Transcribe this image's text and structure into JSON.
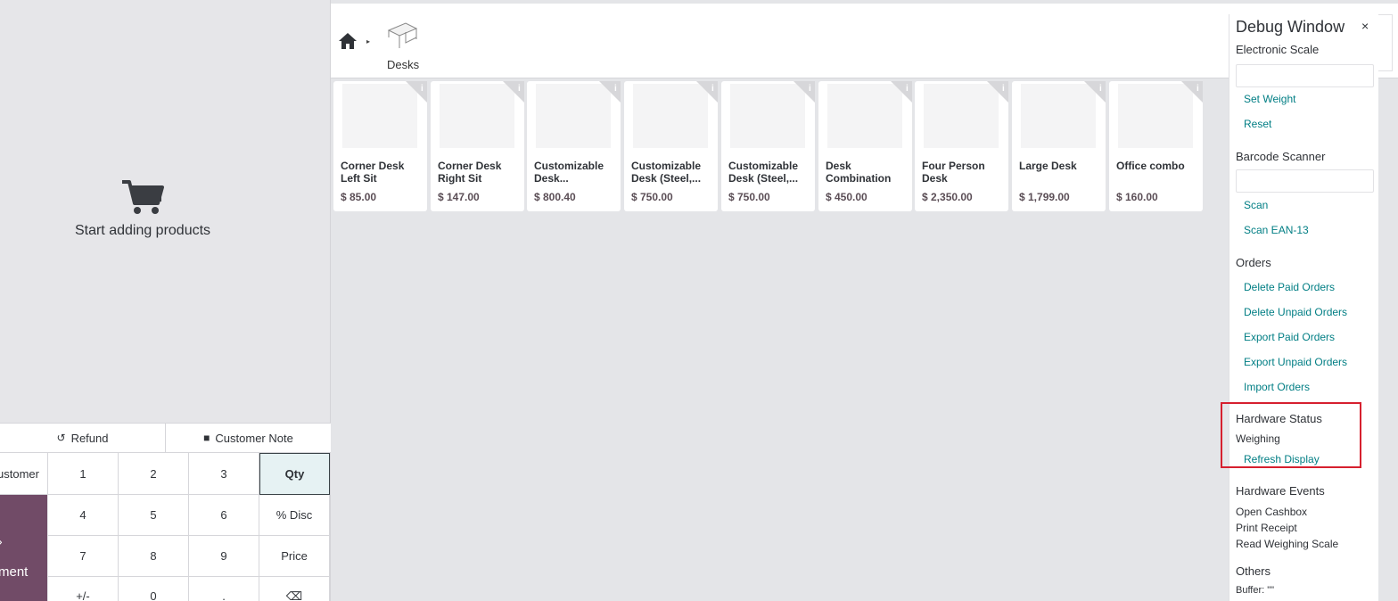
{
  "order_pane": {
    "empty_message": "Start adding products",
    "refund_label": "Refund",
    "customer_note_label": "Customer Note",
    "customer_label": "ustomer",
    "payment_label": "ment",
    "keypad": [
      {
        "label": "1"
      },
      {
        "label": "2"
      },
      {
        "label": "3"
      },
      {
        "label": "Qty"
      },
      {
        "label": "4"
      },
      {
        "label": "5"
      },
      {
        "label": "6"
      },
      {
        "label": "% Disc"
      },
      {
        "label": "7"
      },
      {
        "label": "8"
      },
      {
        "label": "9"
      },
      {
        "label": "Price"
      },
      {
        "label": "+/-"
      },
      {
        "label": "0"
      },
      {
        "label": "."
      },
      {
        "label": "⌫"
      }
    ]
  },
  "breadcrumb": {
    "category_label": "Desks"
  },
  "products": [
    {
      "name": "Corner Desk Left Sit",
      "price": "$ 85.00"
    },
    {
      "name": "Corner Desk Right Sit",
      "price": "$ 147.00"
    },
    {
      "name": "Customizable Desk...",
      "price": "$ 800.40"
    },
    {
      "name": "Customizable Desk (Steel,...",
      "price": "$ 750.00"
    },
    {
      "name": "Customizable Desk (Steel,...",
      "price": "$ 750.00"
    },
    {
      "name": "Desk Combination",
      "price": "$ 450.00"
    },
    {
      "name": "Four Person Desk",
      "price": "$ 2,350.00"
    },
    {
      "name": "Large Desk",
      "price": "$ 1,799.00"
    },
    {
      "name": "Office combo",
      "price": "$ 160.00"
    }
  ],
  "debug": {
    "title": "Debug Window",
    "close": "×",
    "scale_section": "Electronic Scale",
    "set_weight": "Set Weight",
    "reset": "Reset",
    "barcode_section": "Barcode Scanner",
    "scan": "Scan",
    "scan_ean": "Scan EAN-13",
    "orders_section": "Orders",
    "delete_paid": "Delete Paid Orders",
    "delete_unpaid": "Delete Unpaid Orders",
    "export_paid": "Export Paid Orders",
    "export_unpaid": "Export Unpaid Orders",
    "import_orders": "Import Orders",
    "hw_status_section": "Hardware Status",
    "weighing": "Weighing",
    "refresh_display": "Refresh Display",
    "hw_events_section": "Hardware Events",
    "open_cashbox": "Open Cashbox",
    "print_receipt": "Print Receipt",
    "read_scale": "Read Weighing Scale",
    "others_section": "Others",
    "buffer": "Buffer: \"\""
  },
  "colors": {
    "accent": "#714b67",
    "link": "#017e84",
    "highlight": "#d6202f"
  }
}
